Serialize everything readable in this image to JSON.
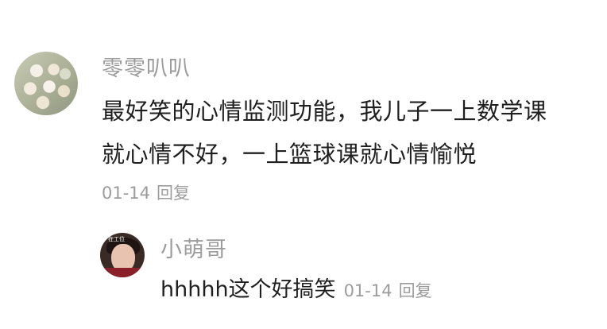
{
  "comment": {
    "username": "零零叭叭",
    "text_line1": "最好笑的心情监测功能，我儿子一上数学课",
    "text_line2": "就心情不好，一上篮球课就心情愉悦",
    "date": "01-14",
    "reply_label": "回复"
  },
  "reply": {
    "username": "小萌哥",
    "avatar_caption": "在工位",
    "text": "hhhhh这个好搞笑",
    "date": "01-14",
    "reply_label": "回复"
  }
}
